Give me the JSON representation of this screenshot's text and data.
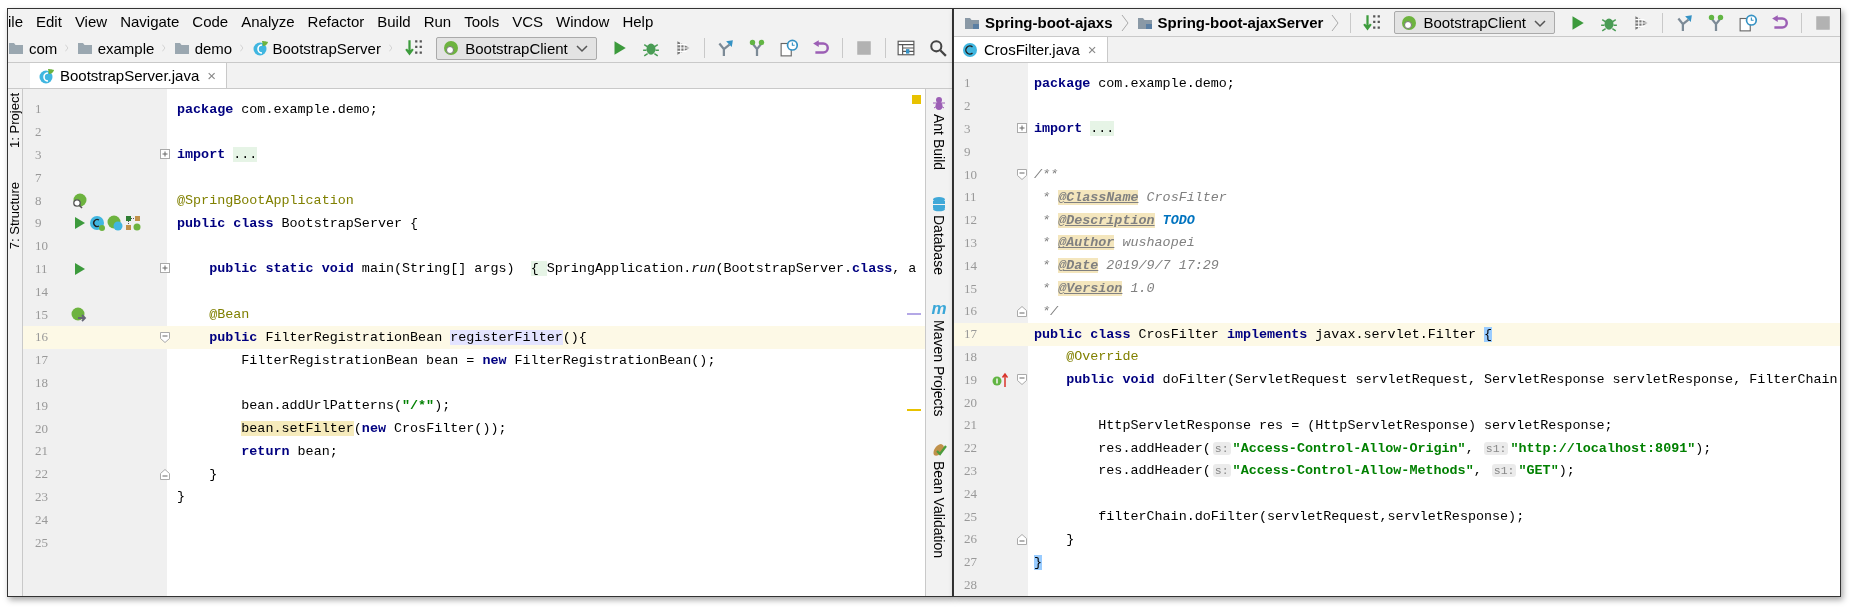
{
  "left_window": {
    "menu": [
      "ile",
      "Edit",
      "View",
      "Navigate",
      "Code",
      "Analyze",
      "Refactor",
      "Build",
      "Run",
      "Tools",
      "VCS",
      "Window",
      "Help"
    ],
    "breadcrumbs": [
      {
        "label": "com",
        "kind": "folder"
      },
      {
        "label": "example",
        "kind": "folder"
      },
      {
        "label": "demo",
        "kind": "folder"
      },
      {
        "label": "BootstrapServer",
        "kind": "springclass"
      }
    ],
    "run_config": "BootstrapClient",
    "toolbar": [
      {
        "kind": "sort",
        "disabled": false
      },
      {
        "kind": "config"
      },
      {
        "kind": "run",
        "disabled": false
      },
      {
        "kind": "debug",
        "disabled": false
      },
      {
        "kind": "coverage",
        "disabled": false
      },
      {
        "kind": "sep"
      },
      {
        "kind": "update",
        "disabled": false
      },
      {
        "kind": "commit",
        "disabled": false
      },
      {
        "kind": "history",
        "disabled": false
      },
      {
        "kind": "revert",
        "disabled": false
      },
      {
        "kind": "sep"
      },
      {
        "kind": "stop",
        "disabled": true
      },
      {
        "kind": "sep"
      },
      {
        "kind": "structure",
        "disabled": false
      },
      {
        "kind": "search",
        "disabled": false
      }
    ],
    "tabs": [
      {
        "label": "BootstrapServer.java",
        "kind": "springclass",
        "close": "×",
        "selected": true
      }
    ],
    "left_panels": [
      "1: Project",
      "7: Structure"
    ],
    "right_panels": [
      {
        "label": "Ant Build",
        "kind": "ant"
      },
      {
        "label": "Database",
        "kind": "database"
      },
      {
        "label": "Maven Projects",
        "kind": "maven",
        "glyph": "m"
      },
      {
        "label": "Bean Validation",
        "kind": "beancheck"
      }
    ],
    "editor": {
      "lines": [
        {
          "number": "1",
          "current": false,
          "tokens": [
            {
              "kind": "kw",
              "text": "package"
            },
            {
              "kind": "p",
              "text": " com.example.demo;"
            }
          ]
        },
        {
          "number": "2",
          "current": false
        },
        {
          "number": "3",
          "current": false,
          "fold": {
            "kind": "plus"
          },
          "tokens": [
            {
              "kind": "kw",
              "text": "import "
            },
            {
              "kind": "fold",
              "text": "..."
            }
          ]
        },
        {
          "number": "7",
          "current": false
        },
        {
          "number": "8",
          "current": false,
          "gutter": [
            {
              "kind": "beansearch"
            }
          ],
          "tokens": [
            {
              "kind": "ann",
              "text": "@SpringBootApplication"
            }
          ]
        },
        {
          "number": "9",
          "current": false,
          "gutter": [
            {
              "kind": "run"
            },
            {
              "kind": "classbean"
            },
            {
              "kind": "beanclass"
            },
            {
              "kind": "diagram"
            }
          ],
          "tokens": [
            {
              "kind": "kw",
              "text": "public class"
            },
            {
              "kind": "p",
              "text": " BootstrapServer {"
            }
          ]
        },
        {
          "number": "10",
          "current": false
        },
        {
          "number": "11",
          "current": false,
          "fold": {
            "kind": "plus"
          },
          "gutter": [
            {
              "kind": "run"
            }
          ],
          "tokens": [
            {
              "kind": "kw",
              "text": "    public static void"
            },
            {
              "kind": "p",
              "text": " main(String[] args) "
            },
            {
              "kind": "fold",
              "text": " { "
            },
            {
              "kind": "p",
              "text": "SpringApplication."
            },
            {
              "kind": "it",
              "text": "run"
            },
            {
              "kind": "p",
              "text": "(BootstrapServer."
            },
            {
              "kind": "kw",
              "text": "class"
            },
            {
              "kind": "p",
              "text": ", a"
            }
          ]
        },
        {
          "number": "14",
          "current": false
        },
        {
          "number": "15",
          "current": false,
          "gutter": [
            {
              "kind": "beanarrow"
            }
          ],
          "tokens": [
            {
              "kind": "ann",
              "text": "    @Bean"
            }
          ]
        },
        {
          "number": "16",
          "current": true,
          "fold": {
            "kind": "open"
          },
          "tokens": [
            {
              "kind": "kw",
              "text": "    public"
            },
            {
              "kind": "p",
              "text": " FilterRegistrationBean "
            },
            {
              "kind": "usage",
              "text": "registerFilter"
            },
            {
              "kind": "p",
              "text": "(){"
            }
          ]
        },
        {
          "number": "17",
          "current": false,
          "tokens": [
            {
              "kind": "p",
              "text": "        FilterRegistrationBean bean = "
            },
            {
              "kind": "kw",
              "text": "new"
            },
            {
              "kind": "p",
              "text": " FilterRegistrationBean();"
            }
          ]
        },
        {
          "number": "18",
          "current": false
        },
        {
          "number": "19",
          "current": false,
          "tokens": [
            {
              "kind": "p",
              "text": "        bean.addUrlPatterns("
            },
            {
              "kind": "str",
              "text": "\"/*\""
            },
            {
              "kind": "p",
              "text": ");"
            }
          ]
        },
        {
          "number": "20",
          "current": false,
          "tokens": [
            {
              "kind": "hl",
              "text": "        bean.setFilter"
            },
            {
              "kind": "p",
              "text": "("
            },
            {
              "kind": "kw",
              "text": "new"
            },
            {
              "kind": "p",
              "text": " CrosFilter());"
            }
          ]
        },
        {
          "number": "21",
          "current": false,
          "tokens": [
            {
              "kind": "kw",
              "text": "        return"
            },
            {
              "kind": "p",
              "text": " bean;"
            }
          ]
        },
        {
          "number": "22",
          "current": false,
          "fold": {
            "kind": "close"
          },
          "tokens": [
            {
              "kind": "p",
              "text": "    }"
            }
          ]
        },
        {
          "number": "23",
          "current": false,
          "tokens": [
            {
              "kind": "p",
              "text": "}"
            }
          ]
        },
        {
          "number": "24",
          "current": false
        },
        {
          "number": "25",
          "current": false
        }
      ]
    }
  },
  "right_window": {
    "breadcrumbs": [
      {
        "label": "Spring-boot-ajaxs",
        "kind": "module"
      },
      {
        "label": "Spring-boot-ajaxServer",
        "kind": "module"
      }
    ],
    "run_config": "BootstrapClient",
    "toolbar": [
      {
        "kind": "sort",
        "disabled": false
      },
      {
        "kind": "config"
      },
      {
        "kind": "run",
        "disabled": false
      },
      {
        "kind": "debug",
        "disabled": false
      },
      {
        "kind": "coverage",
        "disabled": false
      },
      {
        "kind": "sep"
      },
      {
        "kind": "update",
        "disabled": false
      },
      {
        "kind": "commit",
        "disabled": false
      },
      {
        "kind": "history",
        "disabled": false
      },
      {
        "kind": "revert",
        "disabled": false
      },
      {
        "kind": "sep"
      },
      {
        "kind": "stop",
        "disabled": true
      }
    ],
    "tabs": [
      {
        "label": "CrosFilter.java",
        "kind": "class",
        "close": "×",
        "selected": true
      }
    ],
    "editor": {
      "lines": [
        {
          "number": "1",
          "current": false,
          "tokens": [
            {
              "kind": "kw",
              "text": "package"
            },
            {
              "kind": "p",
              "text": " com.example.demo;"
            }
          ]
        },
        {
          "number": "2",
          "current": false
        },
        {
          "number": "3",
          "current": false,
          "fold": {
            "kind": "plus"
          },
          "tokens": [
            {
              "kind": "kw",
              "text": "import "
            },
            {
              "kind": "fold",
              "text": "..."
            }
          ]
        },
        {
          "number": "9",
          "current": false
        },
        {
          "number": "10",
          "current": false,
          "fold": {
            "kind": "open"
          },
          "tokens": [
            {
              "kind": "cmt",
              "text": "/**"
            }
          ]
        },
        {
          "number": "11",
          "current": false,
          "tokens": [
            {
              "kind": "cmt",
              "text": " * "
            },
            {
              "kind": "tag",
              "text": "@ClassName"
            },
            {
              "kind": "cmt",
              "text": " CrosFilter"
            }
          ]
        },
        {
          "number": "12",
          "current": false,
          "tokens": [
            {
              "kind": "cmt",
              "text": " * "
            },
            {
              "kind": "tag",
              "text": "@Description"
            },
            {
              "kind": "todo",
              "text": " TODO"
            }
          ]
        },
        {
          "number": "13",
          "current": false,
          "tokens": [
            {
              "kind": "cmt",
              "text": " * "
            },
            {
              "kind": "tag",
              "text": "@Author"
            },
            {
              "kind": "cmt",
              "text": " wushaopei"
            }
          ]
        },
        {
          "number": "14",
          "current": false,
          "tokens": [
            {
              "kind": "cmt",
              "text": " * "
            },
            {
              "kind": "tag",
              "text": "@Date"
            },
            {
              "kind": "cmt",
              "text": " 2019/9/7 17:29"
            }
          ]
        },
        {
          "number": "15",
          "current": false,
          "tokens": [
            {
              "kind": "cmt",
              "text": " * "
            },
            {
              "kind": "tag",
              "text": "@Version"
            },
            {
              "kind": "cmt",
              "text": " 1.0"
            }
          ]
        },
        {
          "number": "16",
          "current": false,
          "fold": {
            "kind": "close"
          },
          "tokens": [
            {
              "kind": "cmt",
              "text": " */"
            }
          ]
        },
        {
          "number": "17",
          "current": true,
          "tokens": [
            {
              "kind": "kw",
              "text": "public class"
            },
            {
              "kind": "p",
              "text": " CrosFilter "
            },
            {
              "kind": "kw",
              "text": "implements"
            },
            {
              "kind": "p",
              "text": " javax.servlet.Filter "
            },
            {
              "kind": "brace",
              "text": "{"
            }
          ]
        },
        {
          "number": "18",
          "current": false,
          "tokens": [
            {
              "kind": "ann",
              "text": "    @Override"
            }
          ]
        },
        {
          "number": "19",
          "current": false,
          "fold": {
            "kind": "open"
          },
          "gutter": [
            {
              "kind": "implements"
            }
          ],
          "tokens": [
            {
              "kind": "kw",
              "text": "    public void"
            },
            {
              "kind": "p",
              "text": " doFilter(ServletRequest servletRequest, ServletResponse servletResponse, FilterChain"
            }
          ]
        },
        {
          "number": "20",
          "current": false
        },
        {
          "number": "21",
          "current": false,
          "tokens": [
            {
              "kind": "p",
              "text": "        HttpServletResponse res = (HttpServletResponse) servletResponse;"
            }
          ]
        },
        {
          "number": "22",
          "current": false,
          "tokens": [
            {
              "kind": "p",
              "text": "        res.addHeader("
            },
            {
              "kind": "hint",
              "text": "s:"
            },
            {
              "kind": "str",
              "text": "\"Access-Control-Allow-Origin\""
            },
            {
              "kind": "p",
              "text": ", "
            },
            {
              "kind": "hint",
              "text": "s1:"
            },
            {
              "kind": "str",
              "text": "\"http://localhost:8091\""
            },
            {
              "kind": "p",
              "text": ");"
            }
          ]
        },
        {
          "number": "23",
          "current": false,
          "tokens": [
            {
              "kind": "p",
              "text": "        res.addHeader("
            },
            {
              "kind": "hint",
              "text": "s:"
            },
            {
              "kind": "str",
              "text": "\"Access-Control-Allow-Methods\""
            },
            {
              "kind": "p",
              "text": ", "
            },
            {
              "kind": "hint",
              "text": "s1:"
            },
            {
              "kind": "str",
              "text": "\"GET\""
            },
            {
              "kind": "p",
              "text": ");"
            }
          ]
        },
        {
          "number": "24",
          "current": false
        },
        {
          "number": "25",
          "current": false,
          "tokens": [
            {
              "kind": "p",
              "text": "        filterChain.doFilter(servletRequest,servletResponse);"
            }
          ]
        },
        {
          "number": "26",
          "current": false,
          "fold": {
            "kind": "close"
          },
          "tokens": [
            {
              "kind": "p",
              "text": "    }"
            }
          ]
        },
        {
          "number": "27",
          "current": false,
          "tokens": [
            {
              "kind": "brace",
              "text": "}"
            }
          ]
        },
        {
          "number": "28",
          "current": false
        }
      ]
    }
  }
}
